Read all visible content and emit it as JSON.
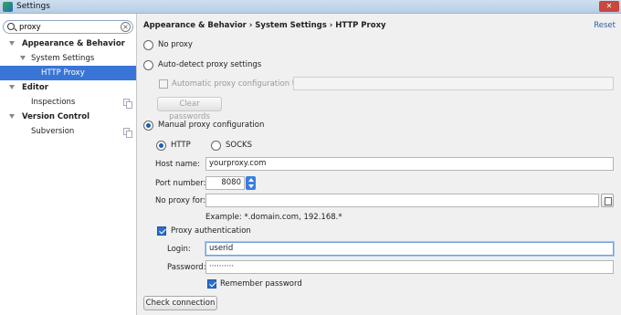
{
  "window": {
    "title": "Settings"
  },
  "search": {
    "value": "proxy"
  },
  "tree": [
    {
      "label": "Appearance & Behavior"
    },
    {
      "label": "System Settings"
    },
    {
      "label": "HTTP Proxy"
    },
    {
      "label": "Editor"
    },
    {
      "label": "Inspections"
    },
    {
      "label": "Version Control"
    },
    {
      "label": "Subversion"
    }
  ],
  "header": {
    "breadcrumb": "Appearance & Behavior › System Settings › HTTP Proxy",
    "reset": "Reset"
  },
  "proxy": {
    "no_proxy": "No proxy",
    "auto_detect": "Auto-detect proxy settings",
    "auto_config_url_label": "Automatic proxy configuration URL:",
    "auto_config_url_value": "",
    "clear_passwords": "Clear passwords",
    "manual": "Manual proxy configuration",
    "http": "HTTP",
    "socks": "SOCKS",
    "host_label": "Host name:",
    "host_value": "yourproxy.com",
    "port_label": "Port number:",
    "port_value": "8080",
    "no_proxy_for_label": "No proxy for:",
    "no_proxy_for_value": "",
    "example": "Example: *.domain.com, 192.168.*",
    "auth_label": "Proxy authentication",
    "login_label": "Login:",
    "login_value": "userid",
    "password_label": "Password:",
    "password_value": "··········",
    "remember_label": "Remember password",
    "check_connection": "Check connection"
  }
}
